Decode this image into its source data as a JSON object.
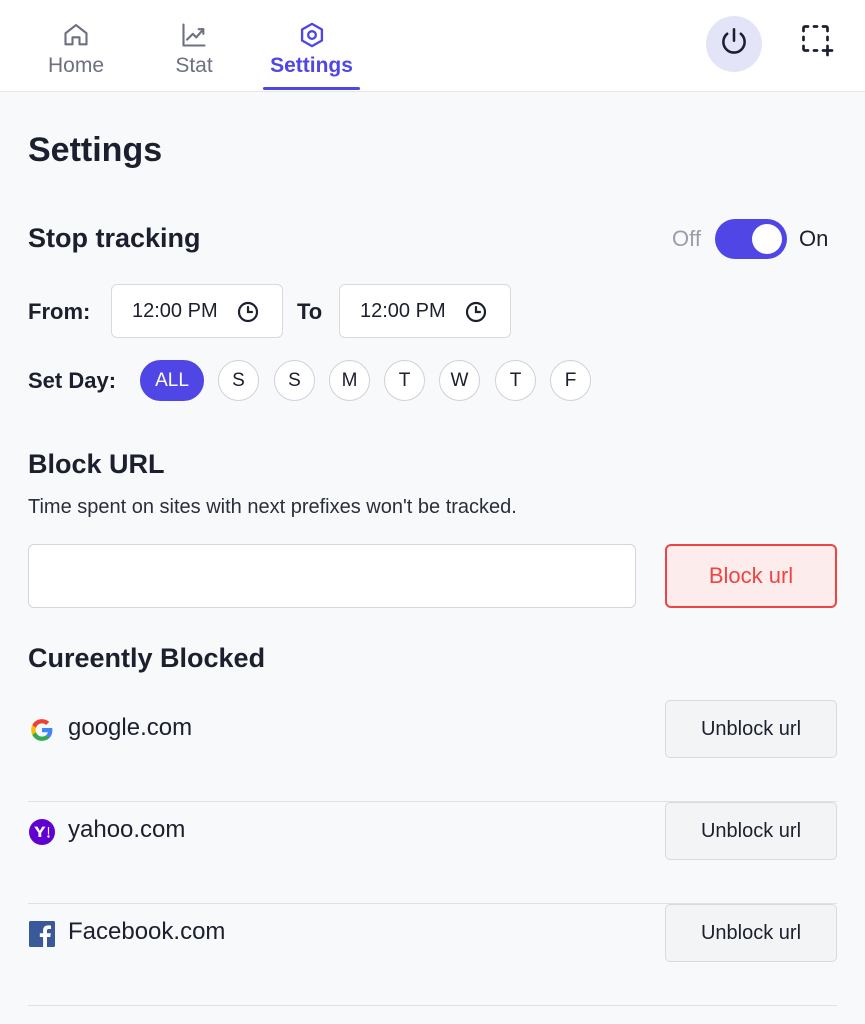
{
  "nav": {
    "tabs": [
      {
        "label": "Home",
        "icon": "home-icon"
      },
      {
        "label": "Stat",
        "icon": "chart-line-icon"
      },
      {
        "label": "Settings",
        "icon": "gear-icon"
      }
    ],
    "active_tab": "Settings",
    "accent_color": "#4f46e5"
  },
  "page": {
    "title": "Settings"
  },
  "stop_tracking": {
    "title": "Stop tracking",
    "toggle_off_label": "Off",
    "toggle_on_label": "On",
    "enabled": true,
    "from_label": "From:",
    "from_time": "12:00 PM",
    "to_label": "To",
    "to_time": "12:00 PM",
    "set_day_label": "Set Day:",
    "days": [
      "ALL",
      "S",
      "S",
      "M",
      "T",
      "W",
      "T",
      "F"
    ],
    "selected_day": "ALL"
  },
  "block_url": {
    "title": "Block URL",
    "description": "Time spent on sites with next prefixes won't be tracked.",
    "input_value": "",
    "button_label": "Block url",
    "button_color": "#ef4444"
  },
  "currently_blocked": {
    "title": "Cureently Blocked",
    "items": [
      {
        "site": "google.com",
        "icon": "google-icon",
        "button": "Unblock url"
      },
      {
        "site": "yahoo.com",
        "icon": "yahoo-icon",
        "button": "Unblock url"
      },
      {
        "site": "Facebook.com",
        "icon": "facebook-icon",
        "button": "Unblock url"
      }
    ]
  }
}
